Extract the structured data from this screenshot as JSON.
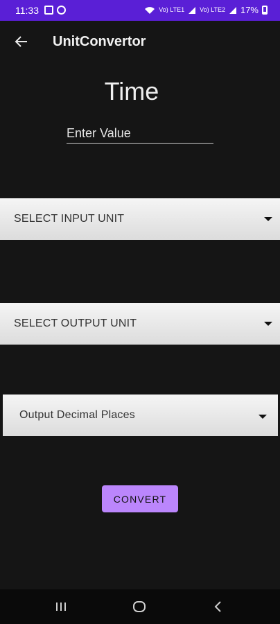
{
  "status_bar": {
    "time": "11:33",
    "battery": "17%",
    "network_label": "Vo) LTE1",
    "network_label_2": "Vo) LTE2"
  },
  "app_bar": {
    "title": "UnitConvertor"
  },
  "main": {
    "heading": "Time",
    "value_input": {
      "value": "",
      "placeholder": "Enter Value"
    },
    "input_unit_select": {
      "label": "SELECT INPUT UNIT"
    },
    "output_unit_select": {
      "label": "SELECT OUTPUT UNIT"
    },
    "decimal_places_select": {
      "label": "Output Decimal Places"
    },
    "convert_label": "CONVERT"
  },
  "colors": {
    "status_bar": "#5a1fd6",
    "background": "#151515",
    "accent_button": "#bb86fc"
  }
}
